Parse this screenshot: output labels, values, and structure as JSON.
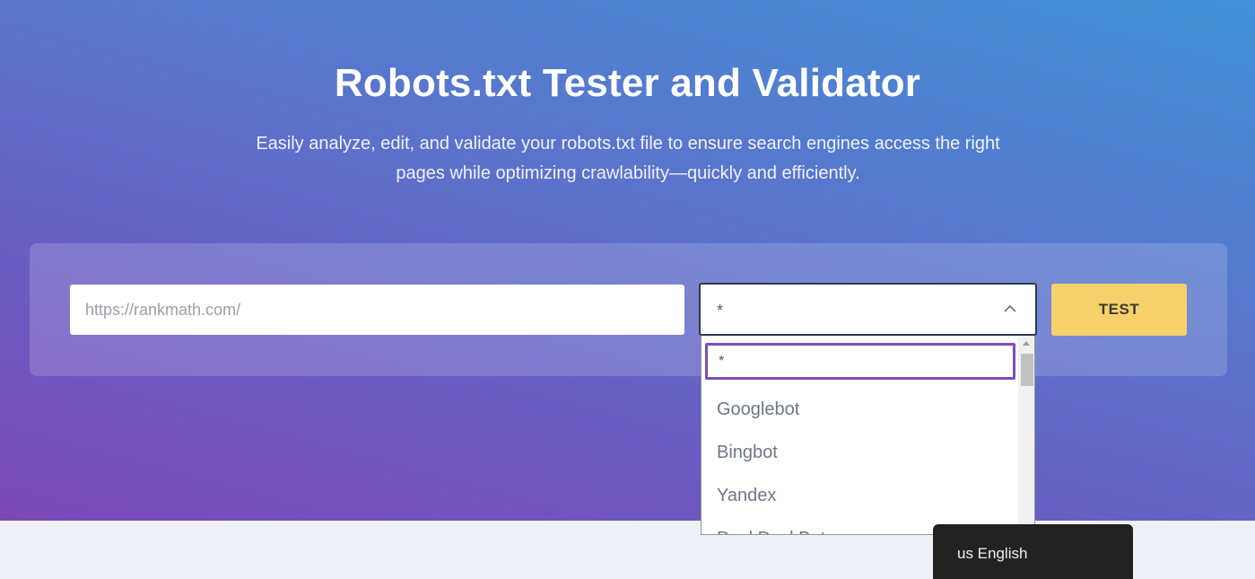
{
  "hero": {
    "title": "Robots.txt Tester and Validator",
    "subtitle": "Easily analyze, edit, and validate your robots.txt file to ensure search engines access the right pages while optimizing crawlability—quickly and efficiently."
  },
  "form": {
    "url_placeholder": "https://rankmath.com/",
    "url_value": "",
    "user_agent_selected": "*",
    "test_label": "TEST"
  },
  "dropdown": {
    "search_value": "*",
    "options": [
      "Googlebot",
      "Bingbot",
      "Yandex",
      "DuckDuckBot"
    ]
  },
  "language": {
    "label": "us English"
  },
  "colors": {
    "gradient_start": "#7a48b6",
    "gradient_end": "#4191d8",
    "test_button": "#f6d06b",
    "focus_border": "#7b4cbd",
    "popup_bg": "#222222"
  },
  "icons": {
    "select_chevron": "chevron-up-icon",
    "scroll_up": "arrow-up-icon",
    "scroll_down": "arrow-down-icon"
  }
}
